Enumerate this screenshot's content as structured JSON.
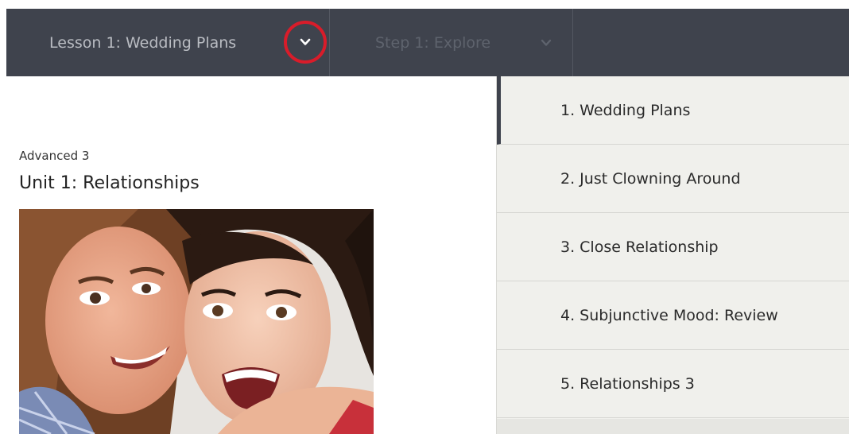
{
  "nav": {
    "lesson_label": "Lesson 1: Wedding Plans",
    "step_label": "Step 1: Explore",
    "lesson_dropdown_icon": "chevron-down-icon",
    "step_dropdown_icon": "chevron-down-icon",
    "highlight_color": "#d91c2a",
    "bar_color": "#3f434d"
  },
  "course": {
    "level": "Advanced 3",
    "unit_title": "Unit 1: Relationships"
  },
  "lesson_menu": {
    "items": [
      {
        "label": "1. Wedding Plans",
        "active": true
      },
      {
        "label": "2. Just Clowning Around",
        "active": false
      },
      {
        "label": "3. Close Relationship",
        "active": false
      },
      {
        "label": "4. Subjunctive Mood: Review",
        "active": false
      },
      {
        "label": "5. Relationships 3",
        "active": false
      }
    ]
  }
}
